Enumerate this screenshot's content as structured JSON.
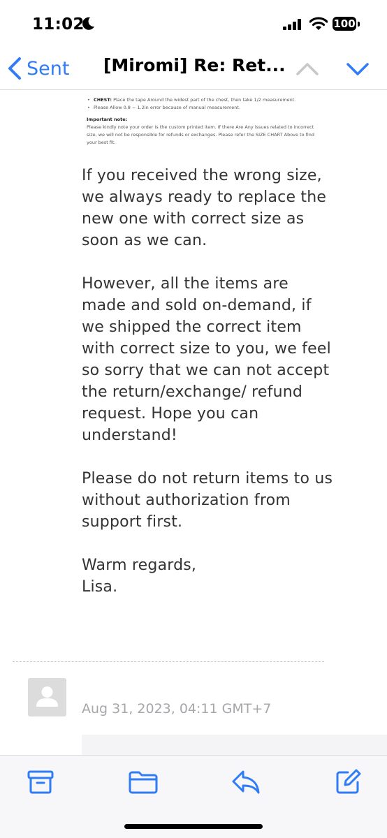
{
  "status_bar": {
    "time": "11:02",
    "battery": "100"
  },
  "nav": {
    "back_label": "Sent",
    "title": "[Miromi] Re: Ret..."
  },
  "snippet": {
    "chest_label": "CHEST:",
    "chest_text": " Place the tape Around the widest part of the chest, then take 1/2 measurement.",
    "allow_text": "Please Allow 0.8 ~ 1.2in error because of manual measurement.",
    "important_title": "Important note:",
    "important_text": "Please kindly note your order is the custom printed item. If there Are Any issues related to incorrect size, we will not be responsible for refunds or exchanges. Please refer the SIZE CHART Above to find your best fit."
  },
  "email_body": {
    "paragraph_1": "If you received the wrong size, we always ready to replace the new one with correct size as soon as we can.",
    "paragraph_2": "However, all the items are made and sold on-demand, if we shipped the correct item with correct size to you, we feel so sorry that we can not accept the return/exchange/ refund request. Hope you can understand!",
    "paragraph_3": "Please do not return items to us without authorization from support first.",
    "signoff": "Warm regards,",
    "name": "Lisa."
  },
  "next_message": {
    "date": "Aug 31, 2023, 04:11 GMT+7"
  },
  "icons": {
    "accent_color": "#2f7cf6",
    "toolbar": [
      "archive-icon",
      "folder-icon",
      "reply-icon",
      "compose-icon"
    ]
  }
}
